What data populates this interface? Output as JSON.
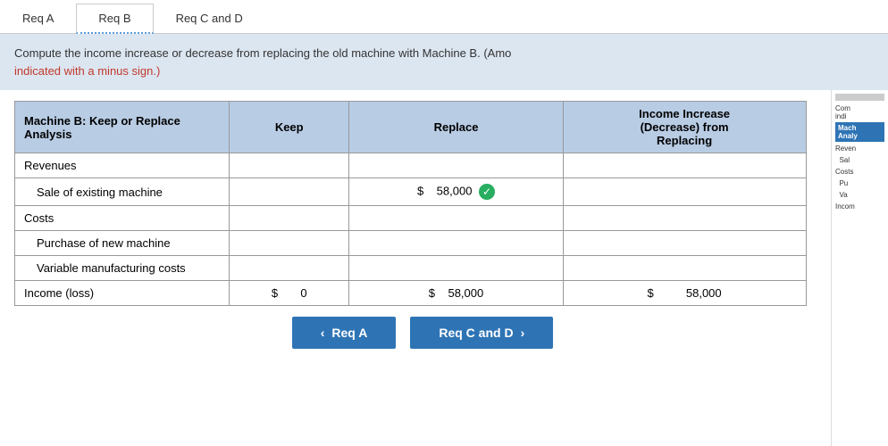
{
  "tabs": [
    {
      "label": "Req A",
      "state": "normal"
    },
    {
      "label": "Req B",
      "state": "active"
    },
    {
      "label": "Req C and D",
      "state": "normal"
    }
  ],
  "instruction": {
    "main_text": "Compute the income increase or decrease from replacing the old machine with Machine B. (Amo",
    "red_text": "indicated with a minus sign.)"
  },
  "table": {
    "headers": [
      "Machine B: Keep or Replace\nAnalysis",
      "Keep",
      "Replace",
      "Income Increase\n(Decrease) from\nReplacing"
    ],
    "rows": [
      {
        "label": "Revenues",
        "indent": false,
        "keep": "",
        "replace": "",
        "income": ""
      },
      {
        "label": "Sale of existing machine",
        "indent": true,
        "keep": "",
        "replace_currency": "$",
        "replace_value": "58,000",
        "replace_check": true,
        "income": ""
      },
      {
        "label": "Costs",
        "indent": false,
        "keep": "",
        "replace": "",
        "income": ""
      },
      {
        "label": "Purchase of new machine",
        "indent": true,
        "keep": "",
        "replace": "",
        "income": ""
      },
      {
        "label": "Variable manufacturing costs",
        "indent": true,
        "keep": "",
        "replace": "",
        "income": ""
      },
      {
        "label": "Income (loss)",
        "indent": false,
        "is_total": true,
        "keep_currency": "$",
        "keep_value": "0",
        "replace_currency": "$",
        "replace_value": "58,000",
        "income_currency": "$",
        "income_value": "58,000"
      }
    ]
  },
  "navigation": {
    "prev_label": "< Req A",
    "next_label": "Req C and D >"
  },
  "side_panel": {
    "title": "Com\nindi",
    "blue_label": "Mach\nAnaly",
    "rows": [
      "Reven",
      "Sal",
      "Costs",
      "Pu",
      "Va",
      "Incom"
    ]
  }
}
